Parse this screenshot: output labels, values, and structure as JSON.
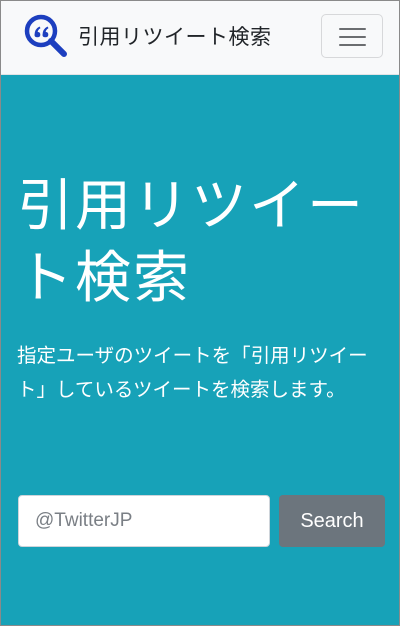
{
  "navbar": {
    "brand_text": "引用リツイート検索",
    "logo_icon": "magnifier-quote-icon",
    "logo_color": "#1d3fbf",
    "toggler_icon": "hamburger-menu-icon"
  },
  "hero": {
    "title": "引用リツイート検索",
    "lead": "指定ユーザのツイートを「引用リツイート」しているツイートを検索します。"
  },
  "search": {
    "placeholder": "@TwitterJP",
    "value": "",
    "button_label": "Search"
  },
  "colors": {
    "hero_background": "#17a2b8",
    "navbar_background": "#f8f9fa",
    "button_background": "#6c757d"
  }
}
